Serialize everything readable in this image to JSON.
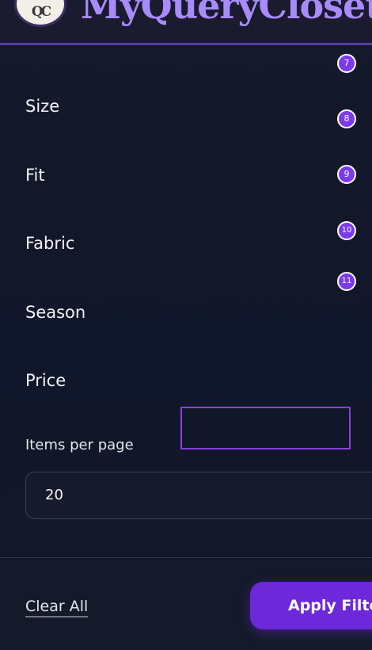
{
  "header": {
    "logo_text": "QC",
    "brand_name": "MyQueryCloset"
  },
  "filters": {
    "size_label": "Size",
    "fit_label": "Fit",
    "fabric_label": "Fabric",
    "season_label": "Season",
    "price_label": "Price"
  },
  "badges": [
    "7",
    "8",
    "9",
    "10",
    "11"
  ],
  "items_per_page": {
    "label": "Items per page",
    "value": "20"
  },
  "footer": {
    "clear_label": "Clear All",
    "apply_label": "Apply Filters"
  },
  "colors": {
    "accent": "#7c3aed",
    "brand": "#a78bfa",
    "background": "#121827"
  }
}
